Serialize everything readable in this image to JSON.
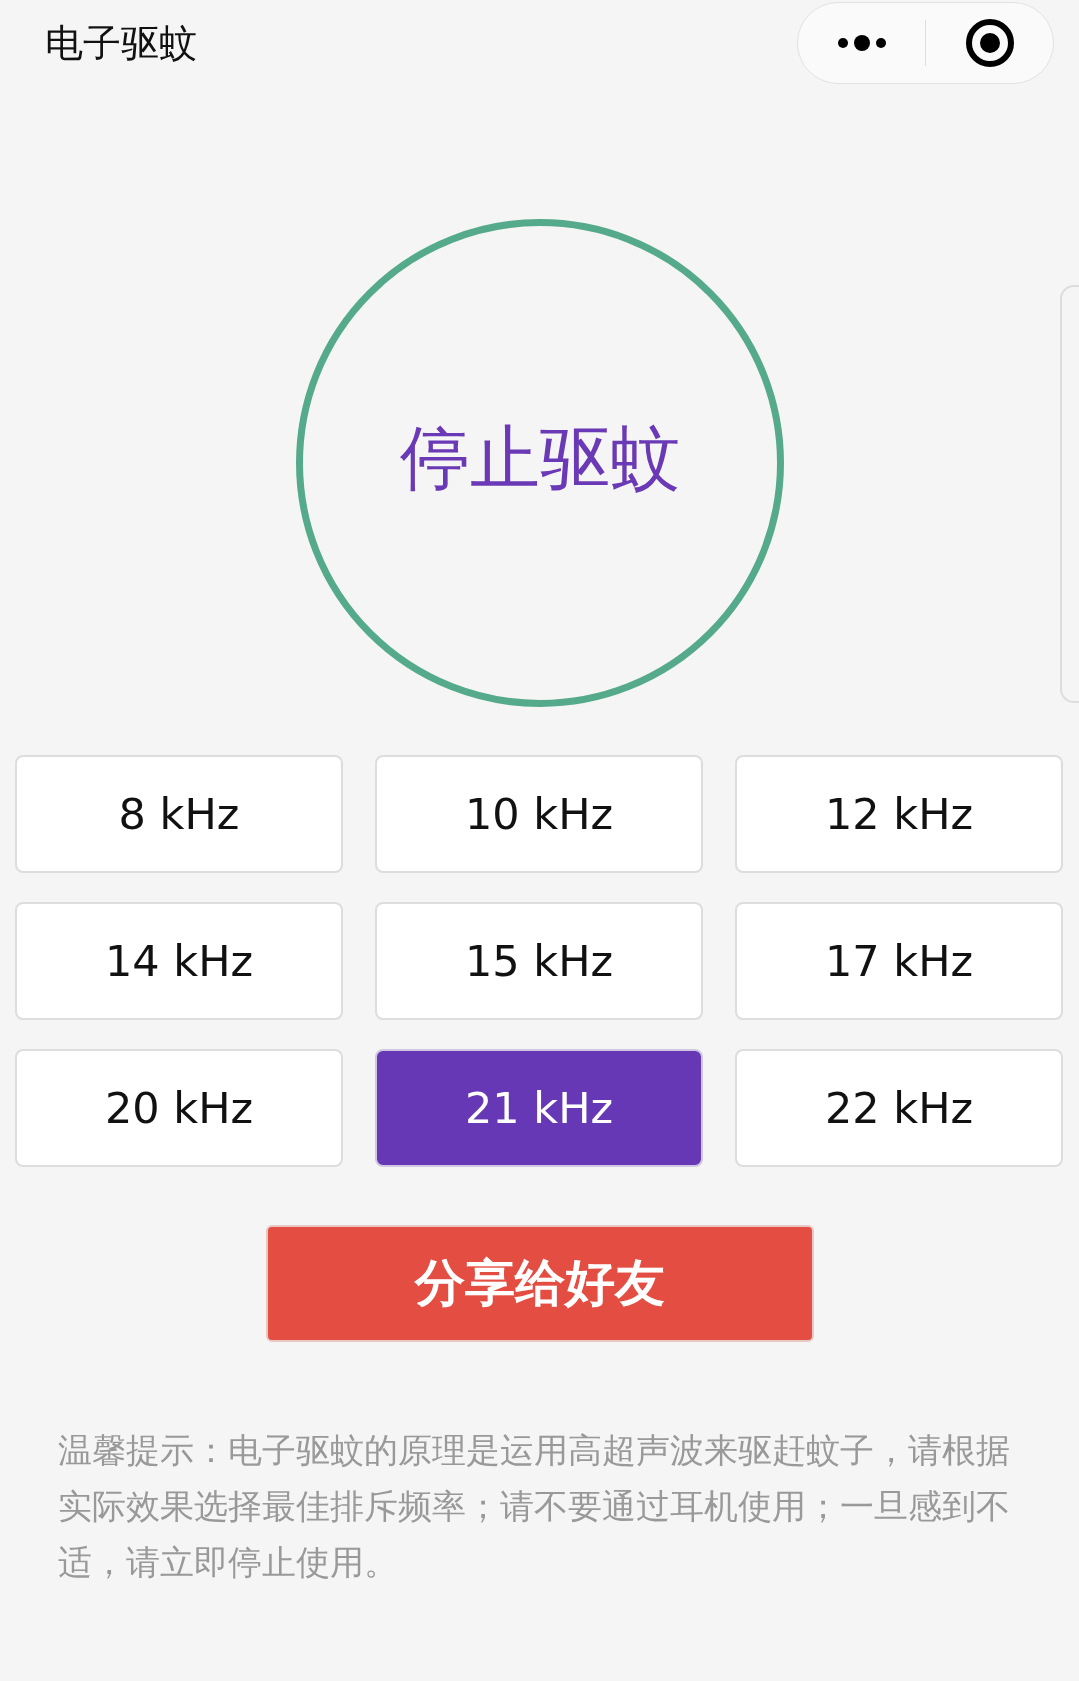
{
  "header": {
    "title": "电子驱蚊"
  },
  "main_button": {
    "label": "停止驱蚊"
  },
  "frequencies": [
    {
      "label": "8 kHz",
      "selected": false
    },
    {
      "label": "10 kHz",
      "selected": false
    },
    {
      "label": "12 kHz",
      "selected": false
    },
    {
      "label": "14 kHz",
      "selected": false
    },
    {
      "label": "15 kHz",
      "selected": false
    },
    {
      "label": "17 kHz",
      "selected": false
    },
    {
      "label": "20 kHz",
      "selected": false
    },
    {
      "label": "21 kHz",
      "selected": true
    },
    {
      "label": "22 kHz",
      "selected": false
    }
  ],
  "share_button": {
    "label": "分享给好友"
  },
  "tip": "温馨提示：电子驱蚊的原理是运用高超声波来驱赶蚊子，请根据实际效果选择最佳排斥频率；请不要通过耳机使用；一旦感到不适，请立即停止使用。"
}
